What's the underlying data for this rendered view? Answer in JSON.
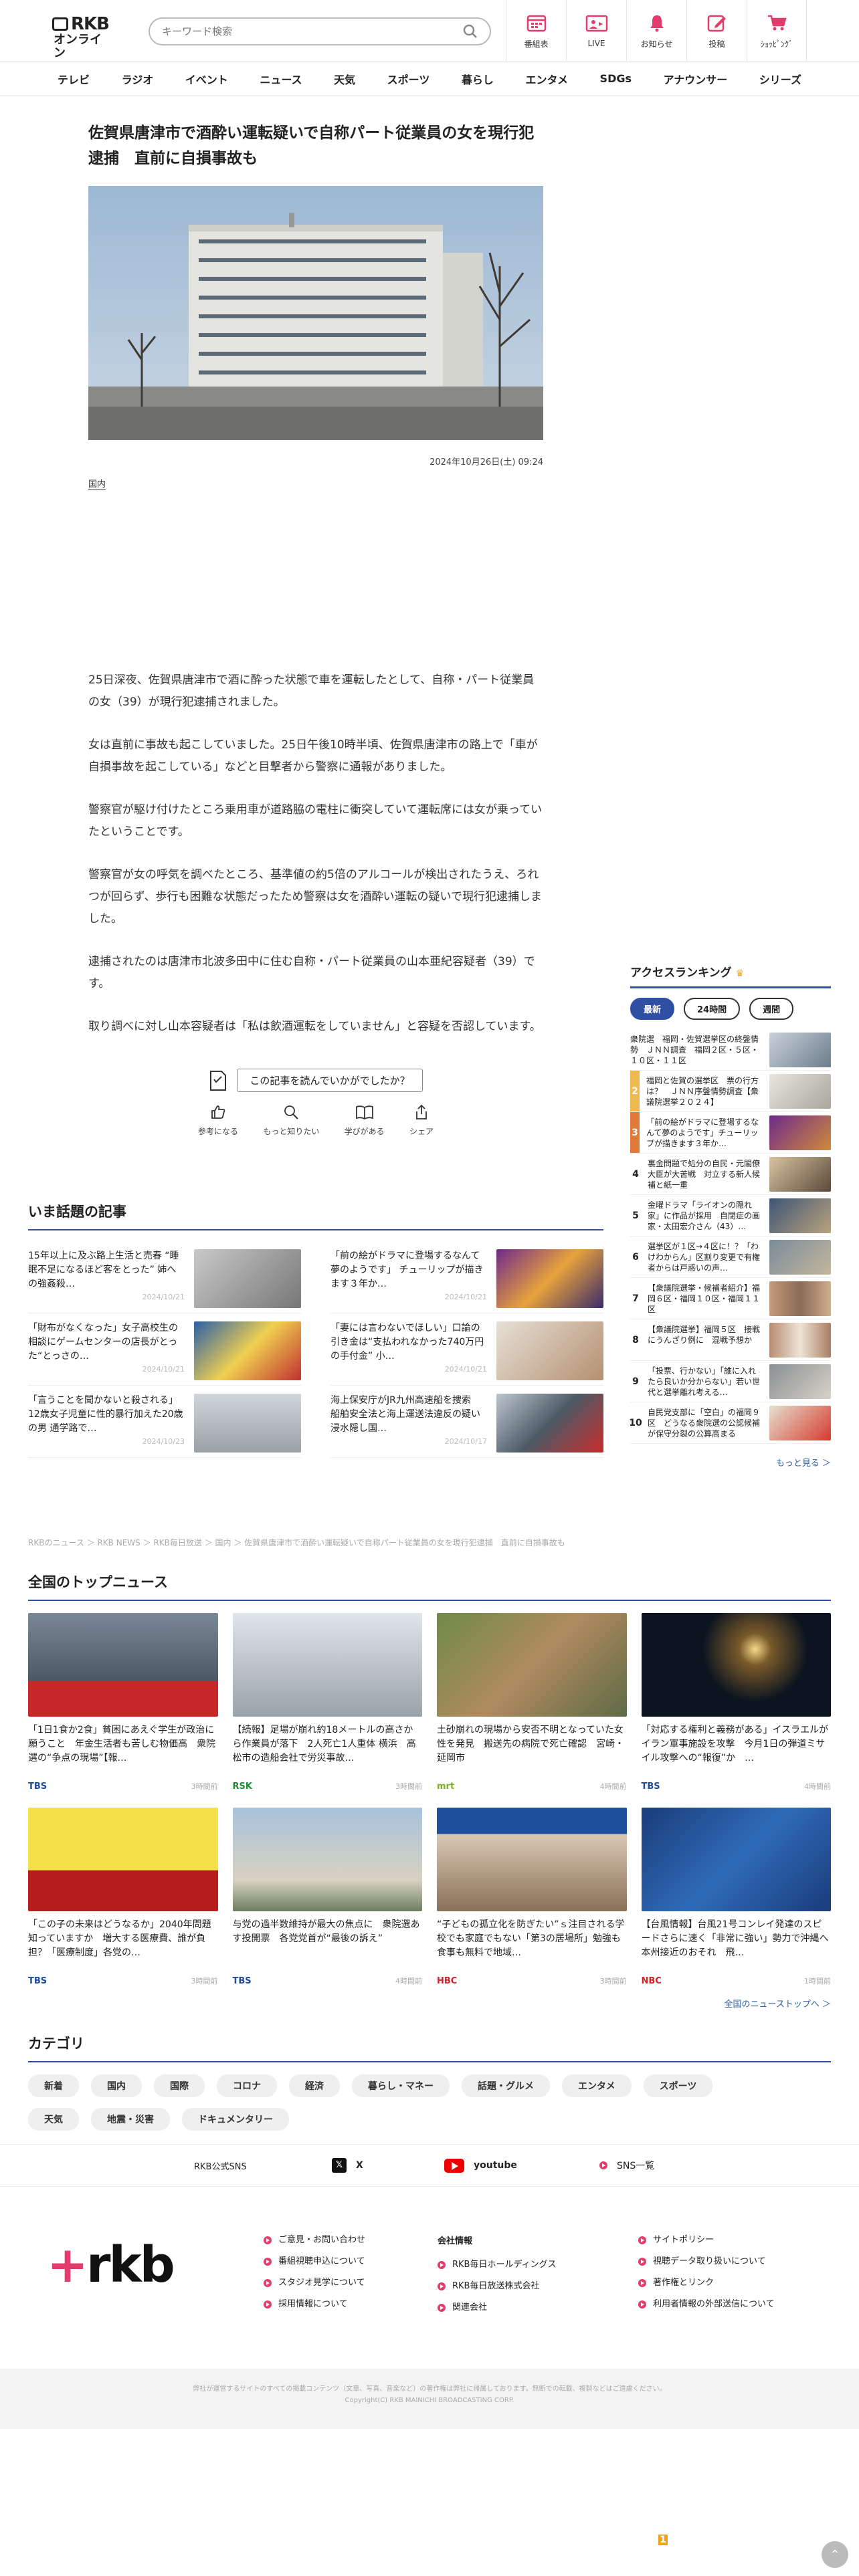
{
  "header": {
    "logo_top": "RKB",
    "logo_bottom": "オンライン",
    "search_placeholder": "キーワード検索",
    "nav": [
      {
        "label": "番組表",
        "icon": "calendar-icon"
      },
      {
        "label": "LIVE",
        "icon": "live-icon"
      },
      {
        "label": "お知らせ",
        "icon": "bell-icon"
      },
      {
        "label": "投稿",
        "icon": "pen-icon"
      },
      {
        "label": "ｼｮｯﾋﾟﾝｸﾞ",
        "icon": "cart-icon"
      }
    ]
  },
  "gnav": [
    "テレビ",
    "ラジオ",
    "イベント",
    "ニュース",
    "天気",
    "スポーツ",
    "暮らし",
    "エンタメ",
    "SDGs",
    "アナウンサー",
    "シリーズ"
  ],
  "article": {
    "title": "佐賀県唐津市で酒酔い運転疑いで自称パート従業員の女を現行犯逮捕　直前に自損事故も",
    "date": "2024年10月26日(土) 09:24",
    "category": "国内",
    "paragraphs": [
      "25日深夜、佐賀県唐津市で酒に酔った状態で車を運転したとして、自称・パート従業員の女（39）が現行犯逮捕されました。",
      "女は直前に事故も起こしていました。25日午後10時半頃、佐賀県唐津市の路上で「車が自損事故を起こしている」などと目撃者から警察に通報がありました。",
      "警察官が駆け付けたところ乗用車が道路脇の電柱に衝突していて運転席には女が乗っていたということです。",
      "警察官が女の呼気を調べたところ、基準値の約5倍のアルコールが検出されたうえ、ろれつが回らず、歩行も困難な状態だったため警察は女を酒酔い運転の疑いで現行犯逮捕しました。",
      "逮捕されたのは唐津市北波多田中に住む自称・パート従業員の山本亜紀容疑者（39）です。",
      "取り調べに対し山本容疑者は「私は飲酒運転をしていません」と容疑を否認しています。"
    ]
  },
  "feedback": {
    "question": "この記事を読んでいかがでしたか？",
    "buttons": [
      "参考になる",
      "もっと知りたい",
      "学びがある",
      "シェア"
    ]
  },
  "ranking": {
    "title": "アクセスランキング",
    "tabs": [
      "最新",
      "24時間",
      "週間"
    ],
    "items": [
      {
        "n": "1",
        "text": "衆院選　福岡・佐賀選挙区の終盤情勢　ＪＮＮ調査　福岡２区・５区・１０区・１１区"
      },
      {
        "n": "2",
        "text": "福岡と佐賀の選挙区　票の行方は？　ＪＮＮ序盤情勢調査【衆議院選挙２０２４】"
      },
      {
        "n": "3",
        "text": "「前の絵がドラマに登場するなんて夢のようです」チューリップが描きます３年か…"
      },
      {
        "n": "4",
        "text": "裏金問題で処分の自民・元閣僚大臣が大苦戦　対立する新人候補と紙一重"
      },
      {
        "n": "5",
        "text": "金曜ドラマ「ライオンの隠れ家」に作品が採用　自閉症の画家・太田宏介さん（43）…"
      },
      {
        "n": "6",
        "text": "選挙区が１区→４区に！？「わけわからん」区割り変更で有権者からは戸惑いの声…"
      },
      {
        "n": "7",
        "text": "【衆議院選挙・候補者紹介】福岡６区・福岡１０区・福岡１１区"
      },
      {
        "n": "8",
        "text": "【衆議院選挙】福岡５区　接戦にうんざり例に　混戦予想か"
      },
      {
        "n": "9",
        "text": "「投票、行かない」「誰に入れたら良いか分からない」若い世代と選挙離れ考える…"
      },
      {
        "n": "10",
        "text": "自民党支部に「空白」の福岡９区　どうなる衆院選の公認候補が保守分裂の公算高まる"
      }
    ],
    "more": "もっと見る ＞"
  },
  "wadai": {
    "title": "いま話題の記事",
    "items": [
      {
        "text": "15年以上に及ぶ路上生活と売春 “睡眠不足になるほど客をとった” 姉への強姦殺…",
        "date": "2024/10/21"
      },
      {
        "text": "「前の絵がドラマに登場するなんて夢のようです」 チューリップが描きます３年か…",
        "date": "2024/10/21"
      },
      {
        "text": "「財布がなくなった」女子高校生の相談にゲームセンターの店長がとった“とっさの…",
        "date": "2024/10/21"
      },
      {
        "text": "「妻には言わないでほしい」口論の引き金は“支払われなかった740万円の手付金” 小…",
        "date": "2024/10/21"
      },
      {
        "text": "「言うことを聞かないと殺される」12歳女子児童に性的暴行加えた20歳の男 通学路で…",
        "date": "2024/10/23"
      },
      {
        "text": "海上保安庁がJR九州高速船を捜索　船舶安全法と海上運送法違反の疑い　浸水隠し国…",
        "date": "2024/10/17"
      }
    ]
  },
  "breadcrumb": "RKBのニュース ＞ RKB NEWS ＞ RKB毎日放送 ＞ 国内 ＞ 佐賀県唐津市で酒酔い運転疑いで自称パート従業員の女を現行犯逮捕　直前に自損事故も",
  "topnews": {
    "title": "全国のトップニュース",
    "items": [
      {
        "text": "「1日1食か2食」貧困にあえぐ学生が政治に願うこと　年金生活者も苦しむ物価高　衆院選の“争点の現場”【報…",
        "station": "TBS",
        "date": "3時間前",
        "color": "#1f4a9a"
      },
      {
        "text": "【続報】足場が崩れ約18メートルの高さから作業員が落下　2人死亡1人重体 横浜　高松市の造船会社で労災事故…",
        "station": "RSK",
        "date": "3時間前",
        "color": "#1c8d3a"
      },
      {
        "text": "土砂崩れの現場から安否不明となっていた女性を発見　搬送先の病院で死亡確認　宮崎・延岡市",
        "station": "mrt",
        "date": "4時間前",
        "color": "#7ab020"
      },
      {
        "text": "「対応する権利と義務がある」イスラエルがイラン軍事施設を攻撃　今月1日の弾道ミサイル攻撃への“報復”か　…",
        "station": "TBS",
        "date": "4時間前",
        "color": "#1f4a9a"
      },
      {
        "text": "「この子の未来はどうなるか」2040年問題知っていますか　増大する医療費、誰が負担？「医療制度」各党の…",
        "station": "TBS",
        "date": "3時間前",
        "color": "#1f4a9a"
      },
      {
        "text": "与党の過半数維持が最大の焦点に　衆院選あす投開票　各党党首が“最後の訴え”",
        "station": "TBS",
        "date": "4時間前",
        "color": "#1f4a9a"
      },
      {
        "text": "“子どもの孤立化を防ぎたい”ｓ注目される学校でも家庭でもない「第3の居場所」勉強も食事も無料で地域…",
        "station": "HBC",
        "date": "3時間前",
        "color": "#d2232a"
      },
      {
        "text": "【台風情報】台風21号コンレイ発達のスピードさらに速く「非常に強い」勢力で沖縄へ　本州接近のおそれ　飛…",
        "station": "NBC",
        "date": "1時間前",
        "color": "#d2232a"
      }
    ],
    "more": "全国のニューストップへ ＞"
  },
  "category": {
    "title": "カテゴリ",
    "chips": [
      "新着",
      "国内",
      "国際",
      "コロナ",
      "経済",
      "暮らし・マネー",
      "話題・グルメ",
      "エンタメ",
      "スポーツ",
      "天気",
      "地震・災害",
      "ドキュメンタリー"
    ]
  },
  "sns": {
    "label": "RKB公式SNS",
    "x": "X",
    "youtube": "youtube",
    "list": "SNS一覧"
  },
  "footer": {
    "logo": "rkb",
    "col1": [
      "ご意見・お問い合わせ",
      "番組視聴申込について",
      "スタジオ見学について",
      "採用情報について"
    ],
    "col2_head": "会社情報",
    "col2": [
      "RKB毎日ホールディングス",
      "RKB毎日放送株式会社",
      "関連会社"
    ],
    "col3": [
      "サイトポリシー",
      "視聴データ取り扱いについて",
      "著作権とリンク",
      "利用者情報の外部送信について"
    ],
    "copy1": "弊社が運営するサイトのすべての掲載コンテンツ（文章、写真、音楽など）の著作権は弊社に帰属しております。無断での転載、複製などはご遠慮ください。",
    "copy2": "Copyright(C) RKB MAINICHI BROADCASTING CORP."
  },
  "colors": {
    "accent": "#2e4fa3",
    "brand": "#e23b6c"
  }
}
